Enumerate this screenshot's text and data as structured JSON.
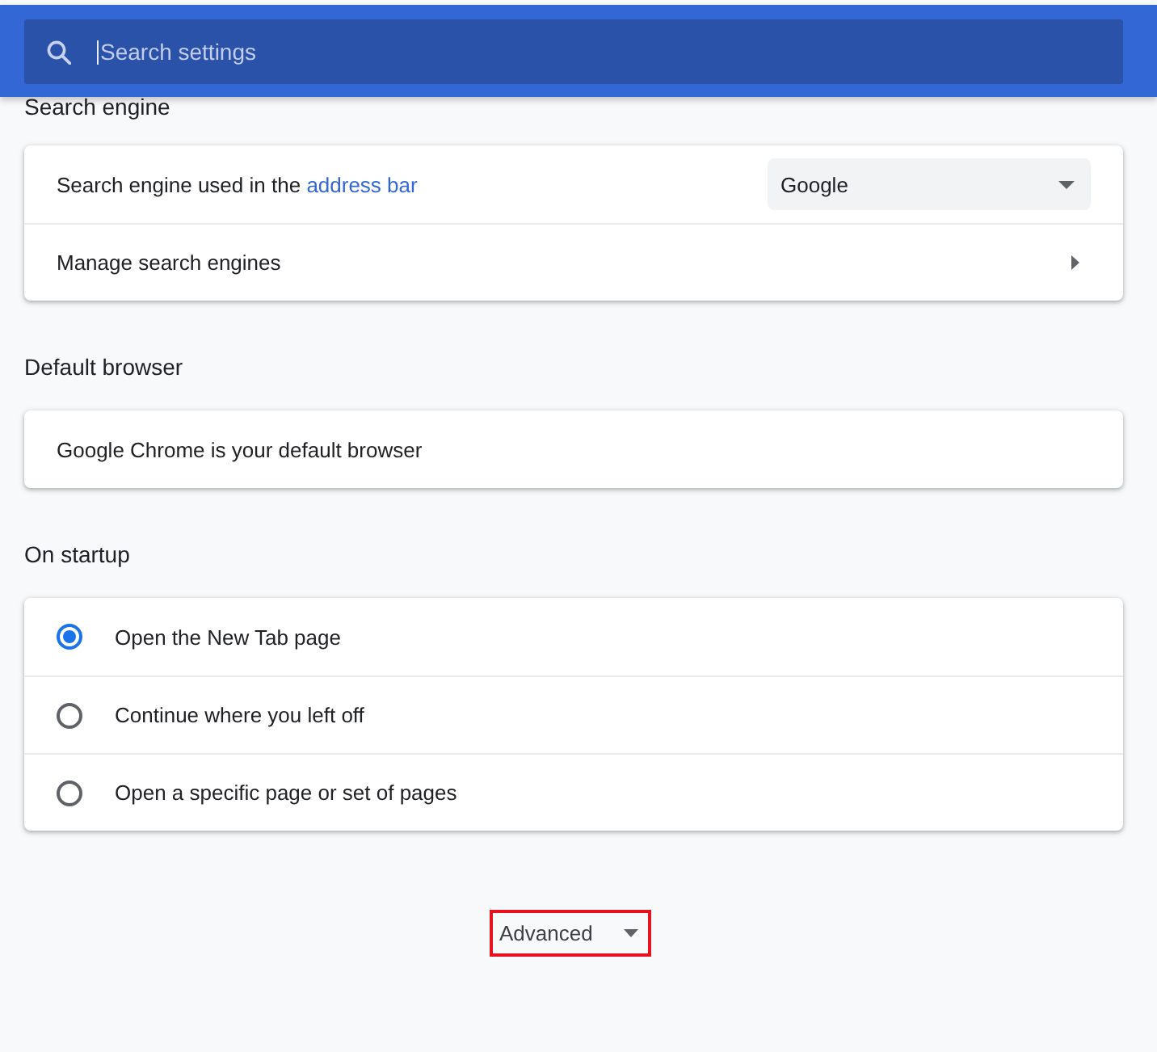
{
  "search": {
    "placeholder": "Search settings"
  },
  "sections": [
    {
      "heading": "Search engine",
      "rows": [
        {
          "kind": "select",
          "label": "Search engine used in the",
          "link": "address bar",
          "value": "Google"
        },
        {
          "kind": "submenu",
          "label": "Manage search engines"
        }
      ]
    },
    {
      "heading": "Default browser",
      "rows": [
        {
          "kind": "text",
          "label": "Google Chrome is your default browser"
        }
      ]
    },
    {
      "heading": "On startup",
      "rows": [
        {
          "kind": "radio",
          "label": "Open the New Tab page",
          "selected": true
        },
        {
          "kind": "radio",
          "label": "Continue where you left off",
          "selected": false
        },
        {
          "kind": "radio",
          "label": "Open a specific page or set of pages",
          "selected": false
        }
      ]
    }
  ],
  "advanced": {
    "label": "Advanced",
    "highlighted": true
  }
}
